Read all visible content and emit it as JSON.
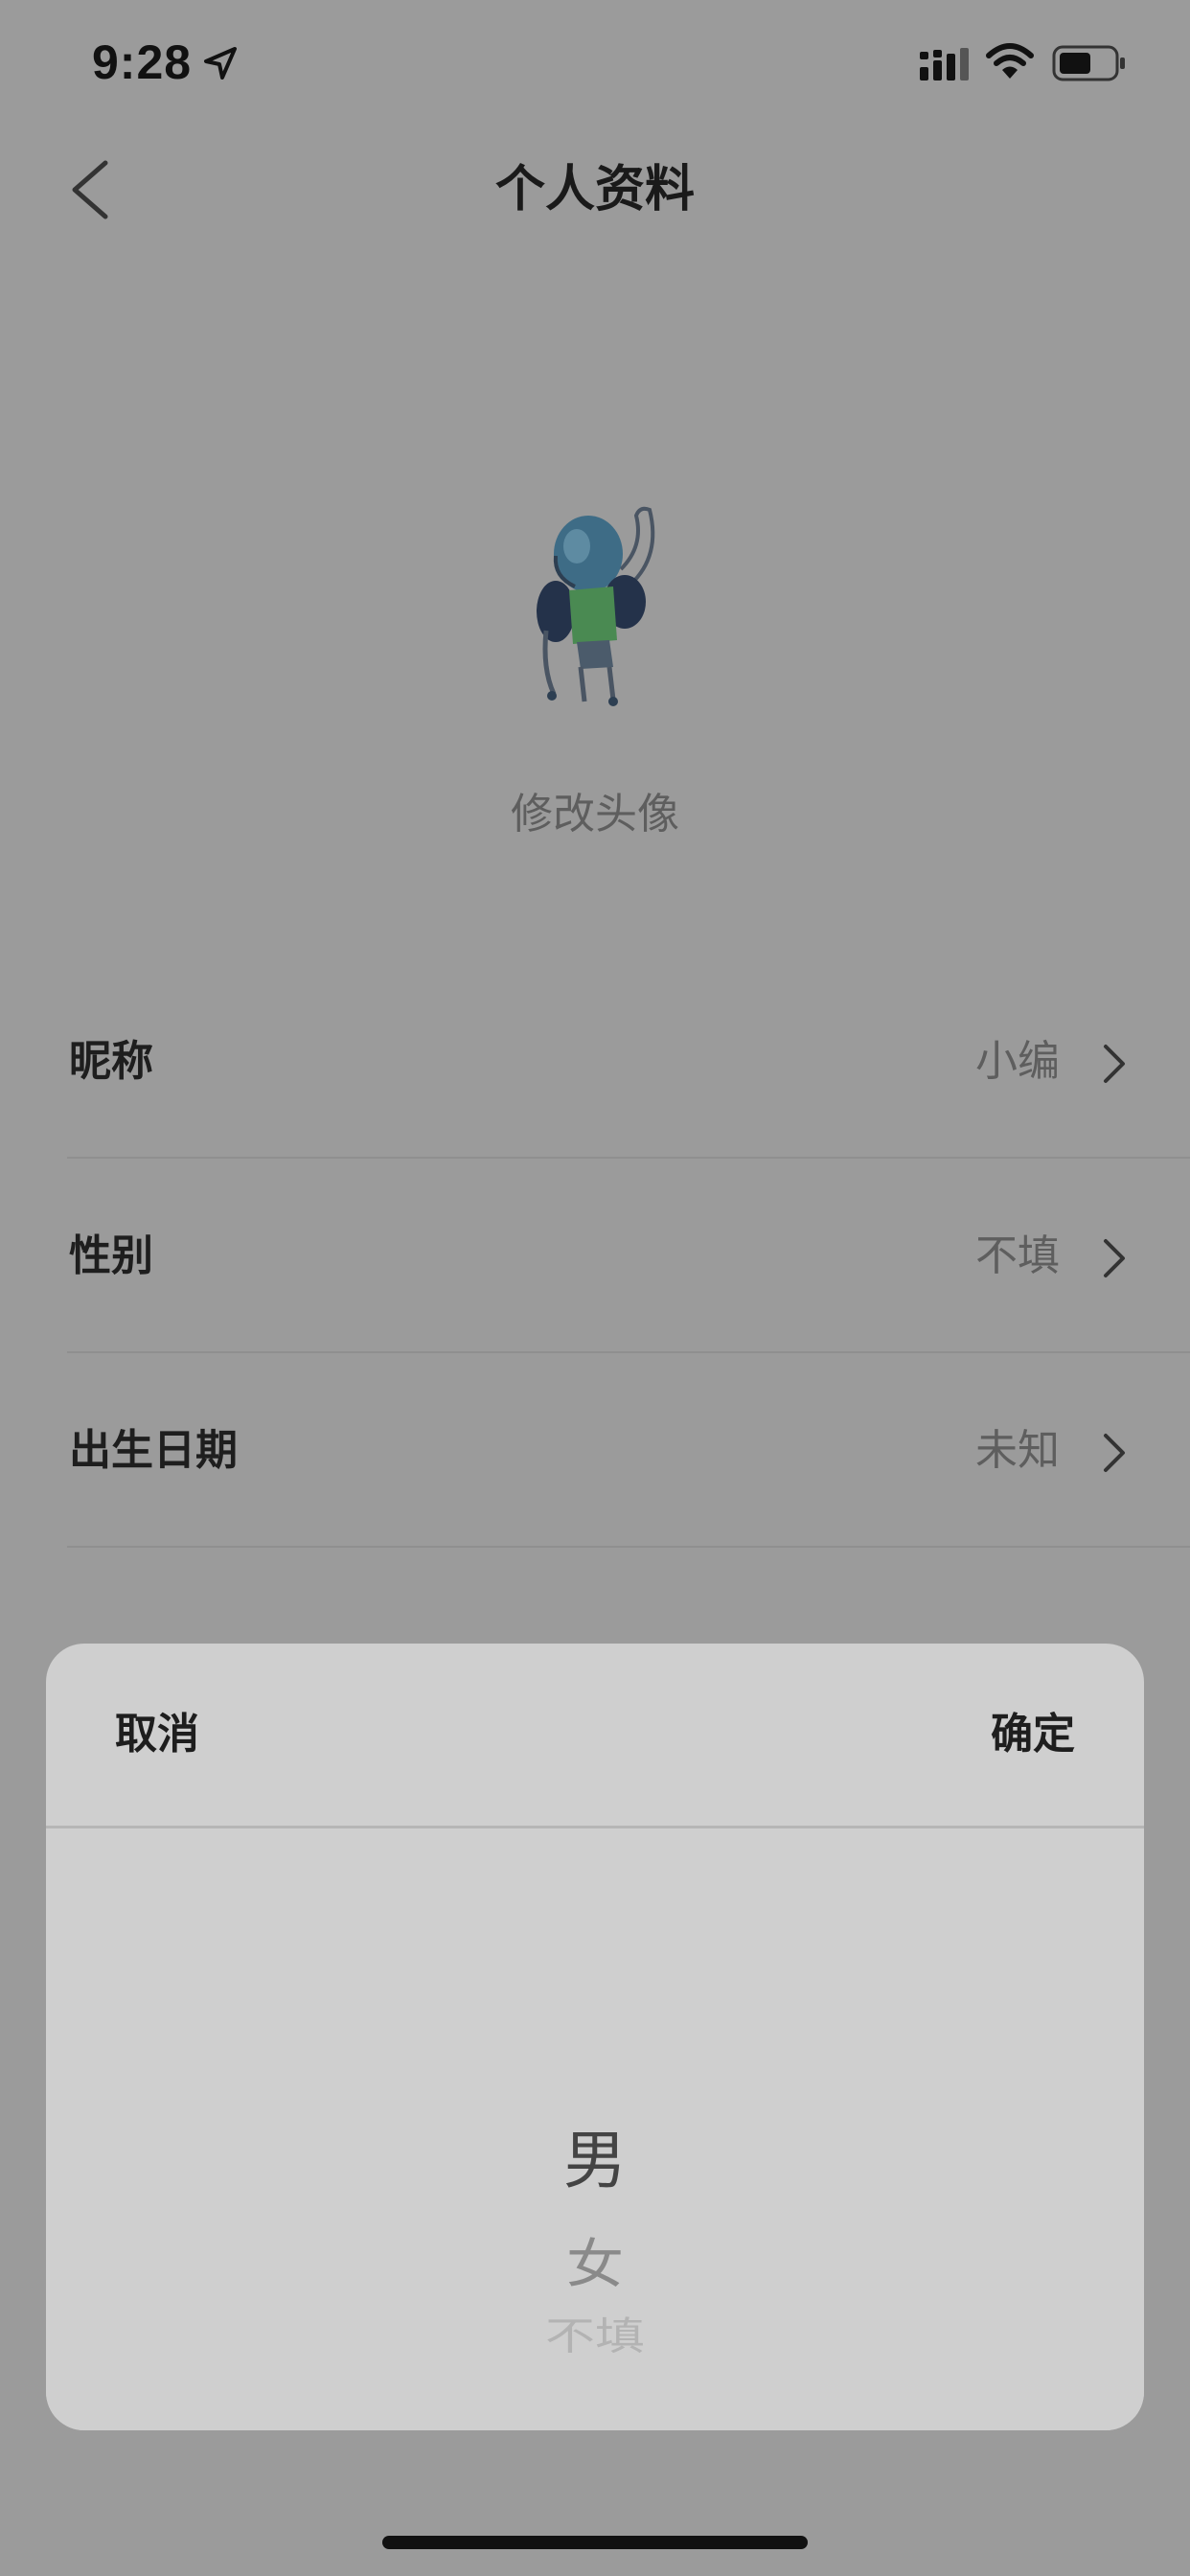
{
  "status_bar": {
    "time": "9:28",
    "icons": [
      "location-arrow-icon",
      "cellular-signal-icon",
      "wifi-icon",
      "battery-icon"
    ]
  },
  "nav": {
    "title": "个人资料",
    "back_icon": "chevron-left-icon"
  },
  "avatar": {
    "caption": "修改头像"
  },
  "settings": {
    "rows": [
      {
        "label": "昵称",
        "value": "小编",
        "icon": "chevron-right-icon"
      },
      {
        "label": "性别",
        "value": "不填",
        "icon": "chevron-right-icon"
      },
      {
        "label": "出生日期",
        "value": "未知",
        "icon": "chevron-right-icon"
      }
    ]
  },
  "picker": {
    "cancel_label": "取消",
    "confirm_label": "确定",
    "options": [
      "男",
      "女",
      "不填"
    ],
    "selected": "男"
  },
  "colors": {
    "overlay_background": "#9b9b9b",
    "sheet_background": "#cfcfcf",
    "primary_text": "#1e1e1e",
    "secondary_text": "#5e5e5e"
  }
}
